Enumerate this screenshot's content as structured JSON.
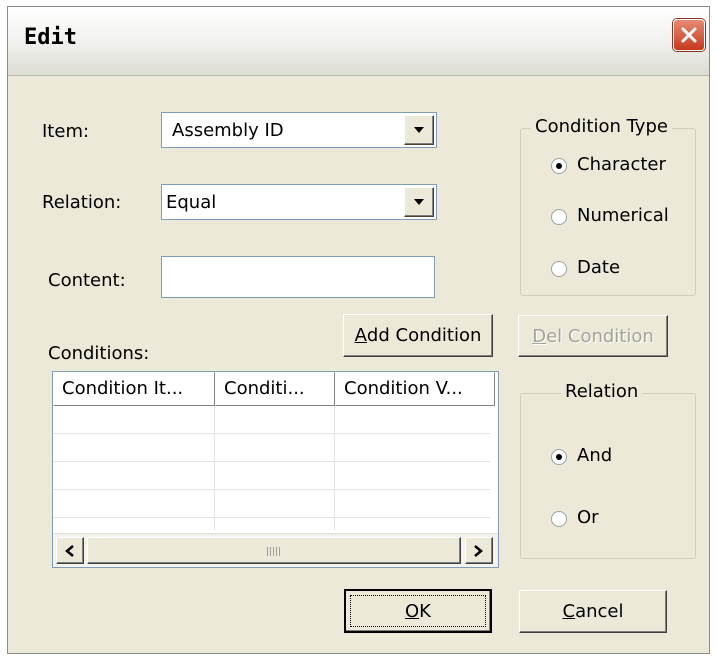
{
  "window": {
    "title": "Edit"
  },
  "form": {
    "item_label": "Item:",
    "item_value": "Assembly ID",
    "relation_label": "Relation:",
    "relation_value": "Equal",
    "content_label": "Content:",
    "content_value": "",
    "conditions_label": "Conditions:"
  },
  "buttons": {
    "add_key": "A",
    "add_rest": "dd Condition",
    "del_key": "D",
    "del_rest": "el Condition",
    "ok_key": "O",
    "ok_rest": "K",
    "cancel_key": "C",
    "cancel_rest": "ancel"
  },
  "condition_type": {
    "legend": "Condition Type",
    "options": [
      "Character",
      "Numerical",
      "Date"
    ],
    "selected": "Character"
  },
  "relation_group": {
    "legend": "Relation",
    "options": [
      "And",
      "Or"
    ],
    "selected": "And"
  },
  "table": {
    "columns": [
      "Condition It...",
      "Conditi...",
      "Condition V..."
    ],
    "rows": [],
    "scroll_grip": "III"
  },
  "icons": {
    "close": "close-icon",
    "dropdown": "chevron-down-icon",
    "scroll_left": "arrow-left-icon",
    "scroll_right": "arrow-right-icon"
  }
}
